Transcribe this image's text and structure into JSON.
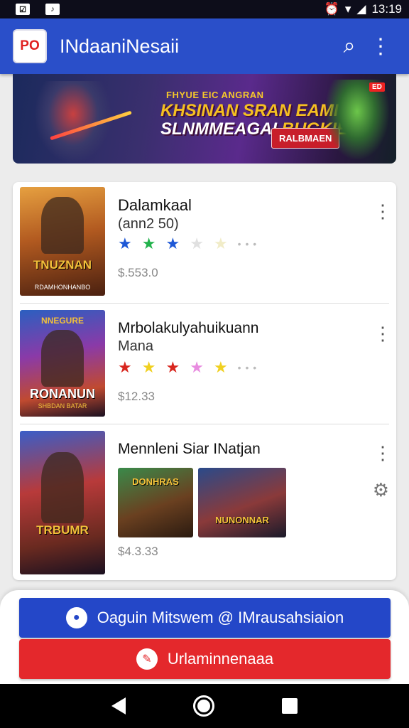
{
  "status_bar": {
    "time": "13:19"
  },
  "app_bar": {
    "logo_text": "PO",
    "title": "INdaaniNesaii"
  },
  "banner": {
    "line1": "FHYUE EIC ANGRAN",
    "line2": "KHSINAN SRAN EAMI",
    "line3": "SLNMMEAGAI",
    "line3_accent": "BUGKIES",
    "cta": "RALBMAEN",
    "badge": "ED"
  },
  "items": [
    {
      "title": "Dalamkaal",
      "subtitle": "(ann2 50)",
      "stars": [
        {
          "color": "#1e58d6"
        },
        {
          "color": "#22b24c"
        },
        {
          "color": "#1e58d6"
        },
        {
          "color": "#e0e0e0"
        },
        {
          "color": "#f1ecc8"
        }
      ],
      "price": "$.553.0",
      "cover_title": "TNUZNAN",
      "cover_sub": "RDAMHONHANBO"
    },
    {
      "title": "Mrbolakulyahuikuann",
      "subtitle": "Mana",
      "stars": [
        {
          "color": "#d8261e"
        },
        {
          "color": "#f0d020"
        },
        {
          "color": "#d8261e"
        },
        {
          "color": "#e88ce0"
        },
        {
          "color": "#f0d020"
        }
      ],
      "price": "$12.33",
      "cover_title": "RONANUN",
      "cover_top": "NNEGURE",
      "cover_sub": "SHBDAN BATAR"
    },
    {
      "title": "Mennleni Siar INatjan",
      "price": "$4.3.33",
      "cover_title": "TRBUMR",
      "thumbs": [
        {
          "label": "DONHRAS"
        },
        {
          "label": "NUNONNAR"
        }
      ]
    }
  ],
  "buttons": {
    "login": "Oaguin Mitswem @ IMrausahsiaion",
    "register": "Urlaminnenaaa"
  }
}
